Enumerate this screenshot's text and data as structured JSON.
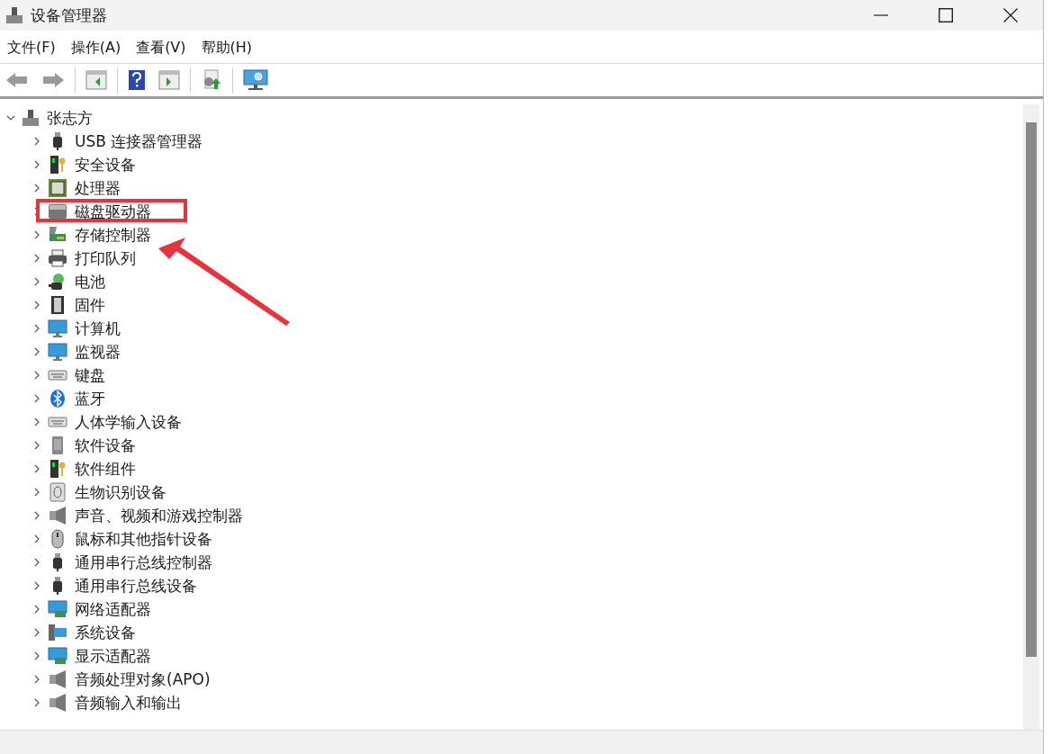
{
  "window": {
    "title": "设备管理器"
  },
  "menu": [
    "文件(F)",
    "操作(A)",
    "查看(V)",
    "帮助(H)"
  ],
  "toolbar": [
    {
      "kind": "back",
      "disabled": true
    },
    {
      "kind": "forward",
      "disabled": true
    },
    {
      "kind": "sep"
    },
    {
      "kind": "console-tree"
    },
    {
      "kind": "sep"
    },
    {
      "kind": "help"
    },
    {
      "kind": "action-pane"
    },
    {
      "kind": "sep"
    },
    {
      "kind": "update-driver"
    },
    {
      "kind": "sep"
    },
    {
      "kind": "scan"
    }
  ],
  "tree": [
    {
      "label": "张志方",
      "expanded": true,
      "children": [
        {
          "label": "USB 连接器管理器",
          "expanded": false
        },
        {
          "label": "安全设备",
          "expanded": false
        },
        {
          "label": "处理器",
          "expanded": false
        },
        {
          "label": "磁盘驱动器",
          "expanded": false
        },
        {
          "label": "存储控制器",
          "expanded": false
        },
        {
          "label": "打印队列",
          "expanded": false
        },
        {
          "label": "电池",
          "expanded": false
        },
        {
          "label": "固件",
          "expanded": false
        },
        {
          "label": "计算机",
          "expanded": false
        },
        {
          "label": "监视器",
          "expanded": false
        },
        {
          "label": "键盘",
          "expanded": false
        },
        {
          "label": "蓝牙",
          "expanded": false
        },
        {
          "label": "人体学输入设备",
          "expanded": false
        },
        {
          "label": "软件设备",
          "expanded": false
        },
        {
          "label": "软件组件",
          "expanded": false
        },
        {
          "label": "生物识别设备",
          "expanded": false
        },
        {
          "label": "声音、视频和游戏控制器",
          "expanded": false
        },
        {
          "label": "鼠标和其他指针设备",
          "expanded": false
        },
        {
          "label": "通用串行总线控制器",
          "expanded": false
        },
        {
          "label": "通用串行总线设备",
          "expanded": false
        },
        {
          "label": "网络适配器",
          "expanded": false
        },
        {
          "label": "系统设备",
          "expanded": false
        },
        {
          "label": "显示适配器",
          "expanded": false
        },
        {
          "label": "音频处理对象(APO)",
          "expanded": false
        },
        {
          "label": "音频输入和输出",
          "expanded": false
        }
      ]
    }
  ],
  "highlight_box": {
    "color": "#e8323c"
  },
  "arrow": {
    "color": "#e8323c"
  }
}
